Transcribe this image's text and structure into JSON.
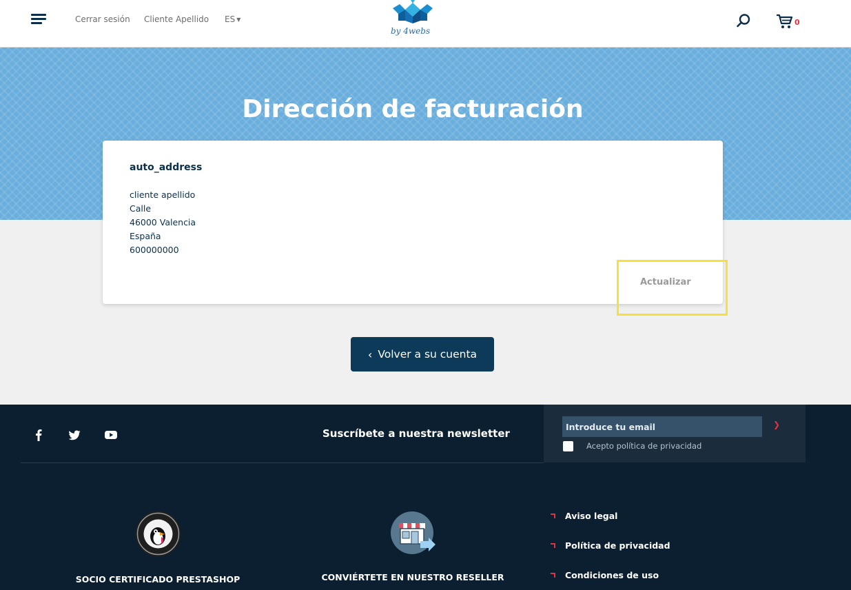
{
  "header": {
    "logout_label": "Cerrar sesión",
    "client_name": "Cliente Apellido",
    "language": "ES",
    "logo_text": "by 4webs",
    "cart_count": "0"
  },
  "page": {
    "title": "Dirección de facturación"
  },
  "address": {
    "alias": "auto_address",
    "lines": [
      "cliente apellido",
      "Calle",
      "46000 Valencia",
      "España",
      "600000000"
    ],
    "update_label": "Actualizar"
  },
  "back_button": {
    "label": "Volver a su cuenta"
  },
  "footer": {
    "social": [
      "facebook-icon",
      "twitter-icon",
      "youtube-icon"
    ],
    "newsletter_title": "Suscríbete a nuestra newsletter",
    "email_placeholder": "Introduce tu email",
    "privacy_label": "Acepto política de privacidad",
    "prestashop_label": "SOCIO CERTIFICADO PRESTASHOP",
    "reseller_label": "CONVIÉRTETE EN NUESTRO RESELLER",
    "legal_links": [
      "Aviso legal",
      "Política de privacidad",
      "Condiciones de uso"
    ]
  },
  "colors": {
    "navy": "#0b2f4a",
    "hero_blue": "#6aaedd",
    "footer_bg": "#0b1f30",
    "accent_red": "#e5303f",
    "highlight_yellow": "#f6e13a"
  }
}
